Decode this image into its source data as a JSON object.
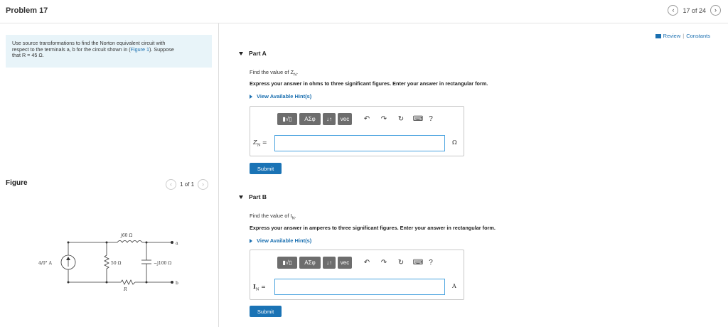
{
  "header": {
    "title": "Problem 17",
    "page_indicator": "17 of 24",
    "prev_icon": "chevron-left-icon",
    "next_icon": "chevron-right-icon"
  },
  "left": {
    "intro_line1": "Use source transformations to find the Norton equivalent circuit with",
    "intro_line2_pre": "respect to the terminals a, b for the circuit shown in (",
    "intro_link": "Figure 1",
    "intro_line2_post": "). Suppose",
    "intro_line3": "that R = 45 Ω.",
    "figure_label": "Figure",
    "figure_pager": "1 of 1",
    "circuit": {
      "source": "4/0° A",
      "r1": "50 Ω",
      "inductor": "j60 Ω",
      "capacitor": "−j100 Ω",
      "r": "R",
      "terminal_a": "a",
      "terminal_b": "b"
    }
  },
  "right": {
    "review_label": "Review",
    "review_sep": "|",
    "constants_label": "Constants",
    "toolbar": {
      "sqrt": "▮√▯",
      "greek": "AΣφ",
      "arrows": "↓↑",
      "vec": "vec",
      "undo_icon": "undo-icon",
      "redo_icon": "redo-icon",
      "reset_icon": "reset-icon",
      "keyboard_icon": "keyboard-icon",
      "help": "?"
    },
    "partA": {
      "title": "Part A",
      "question": "Find the value of Z",
      "question_sub": "N",
      "question_end": ".",
      "instruction": "Express your answer in ohms to three significant figures. Enter your answer in rectangular form.",
      "hints": "View Available Hint(s)",
      "var_label": "Z",
      "var_sub": "N",
      "var_eq": " =",
      "input_value": "",
      "unit": "Ω",
      "submit": "Submit"
    },
    "partB": {
      "title": "Part B",
      "question": "Find the value of I",
      "question_sub": "N",
      "question_end": ".",
      "instruction": "Express your answer in amperes to three significant figures. Enter your answer in rectangular form.",
      "hints": "View Available Hint(s)",
      "var_label": "I",
      "var_sub": "N",
      "var_eq": " =",
      "input_value": "",
      "unit": "A",
      "submit": "Submit"
    }
  }
}
